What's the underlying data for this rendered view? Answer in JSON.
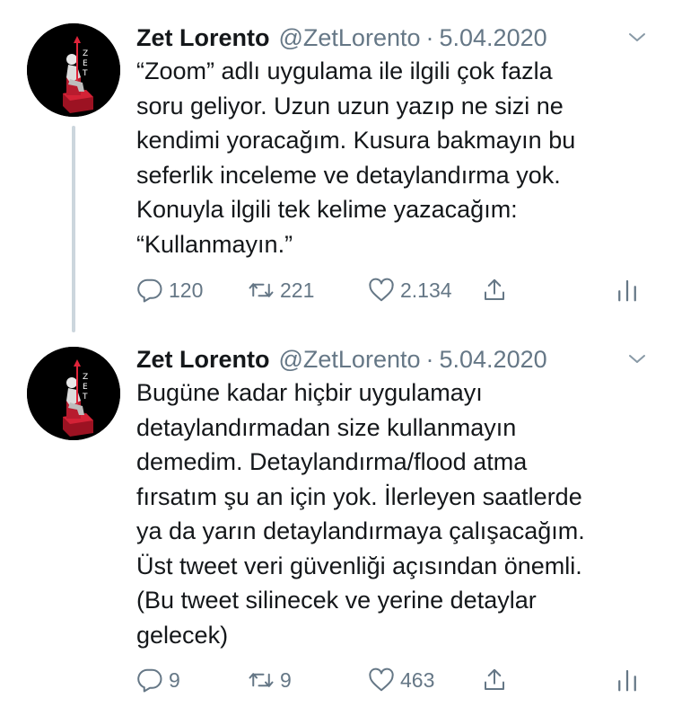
{
  "tweets": [
    {
      "name": "Zet Lorento",
      "handle": "@ZetLorento",
      "separator": "·",
      "date": "5.04.2020",
      "text": "“Zoom” adlı uygulama ile ilgili çok fazla\nsoru geliyor. Uzun uzun yazıp ne sizi ne\nkendimi yoracağım. Kusura bakmayın bu\nseferlik inceleme ve detaylandırma yok.\nKonuyla ilgili tek kelime yazacağım:\n“Kullanmayın.”",
      "replies": "120",
      "retweets": "221",
      "likes": "2.134"
    },
    {
      "name": "Zet Lorento",
      "handle": "@ZetLorento",
      "separator": "·",
      "date": "5.04.2020",
      "text": "Bugüne kadar hiçbir uygulamayı\ndetaylandırmadan size kullanmayın\ndemedim. Detaylandırma/flood atma\nfırsatım şu an için yok. İlerleyen saatlerde\nya da yarın detaylandırmaya çalışacağım.\nÜst tweet veri güvenliği açısından önemli.\n(Bu tweet silinecek ve yerine detaylar\ngelecek)",
      "replies": "9",
      "retweets": "9",
      "likes": "463"
    }
  ],
  "avatar_letters": [
    "Z",
    "E",
    "T"
  ],
  "icons": [
    "reply-icon",
    "retweet-icon",
    "like-icon",
    "share-icon",
    "analytics-icon",
    "chevron-down-icon"
  ],
  "colors": {
    "text": "#14171a",
    "secondary": "#657786",
    "thread_line": "#ccd6dd",
    "avatar_red": "#c0192b"
  }
}
